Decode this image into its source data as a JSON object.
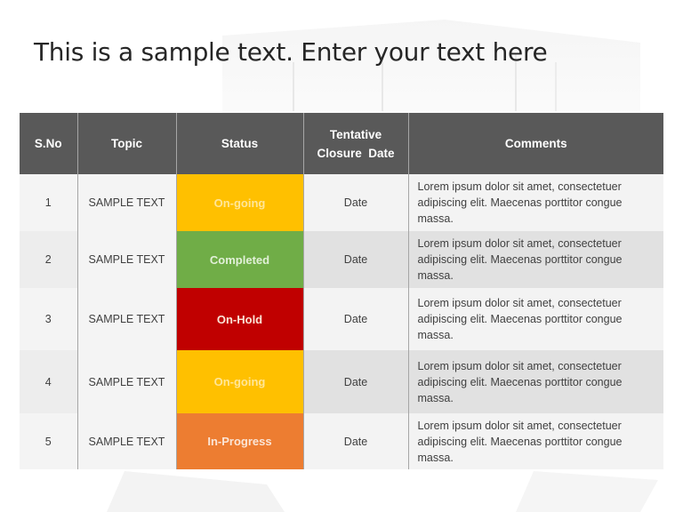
{
  "title": "This is a sample text. Enter your text here",
  "table": {
    "headers": {
      "sno": "S.No",
      "topic": "Topic",
      "status": "Status",
      "date_line1": "Tentative",
      "date_line2": "Closure  Date",
      "comments": "Comments"
    },
    "rows": [
      {
        "sno": "1",
        "topic": "SAMPLE TEXT",
        "status": "On-going",
        "status_color": "#ffc000",
        "status_text_color": "#ffe699",
        "date": "Date",
        "comment": "Lorem ipsum dolor sit amet, consectetuer adipiscing elit. Maecenas porttitor congue massa."
      },
      {
        "sno": "2",
        "topic": "SAMPLE TEXT",
        "status": "Completed",
        "status_color": "#70ad47",
        "status_text_color": "#e2f0d9",
        "date": "Date",
        "comment": "Lorem ipsum dolor sit amet, consectetuer adipiscing elit. Maecenas porttitor congue massa."
      },
      {
        "sno": "3",
        "topic": "SAMPLE TEXT",
        "status": "On-Hold",
        "status_color": "#c00000",
        "status_text_color": "#fbe5d6",
        "date": "Date",
        "comment": "Lorem ipsum dolor sit amet, consectetuer adipiscing elit. Maecenas porttitor congue massa."
      },
      {
        "sno": "4",
        "topic": "SAMPLE TEXT",
        "status": "On-going",
        "status_color": "#ffc000",
        "status_text_color": "#ffe699",
        "date": "Date",
        "comment": "Lorem ipsum dolor sit amet, consectetuer adipiscing elit. Maecenas porttitor congue massa."
      },
      {
        "sno": "5",
        "topic": "SAMPLE TEXT",
        "status": "In-Progress",
        "status_color": "#ed7d31",
        "status_text_color": "#fbe5d6",
        "date": "Date",
        "comment": "Lorem ipsum dolor sit amet, consectetuer adipiscing elit. Maecenas porttitor congue massa."
      }
    ]
  }
}
